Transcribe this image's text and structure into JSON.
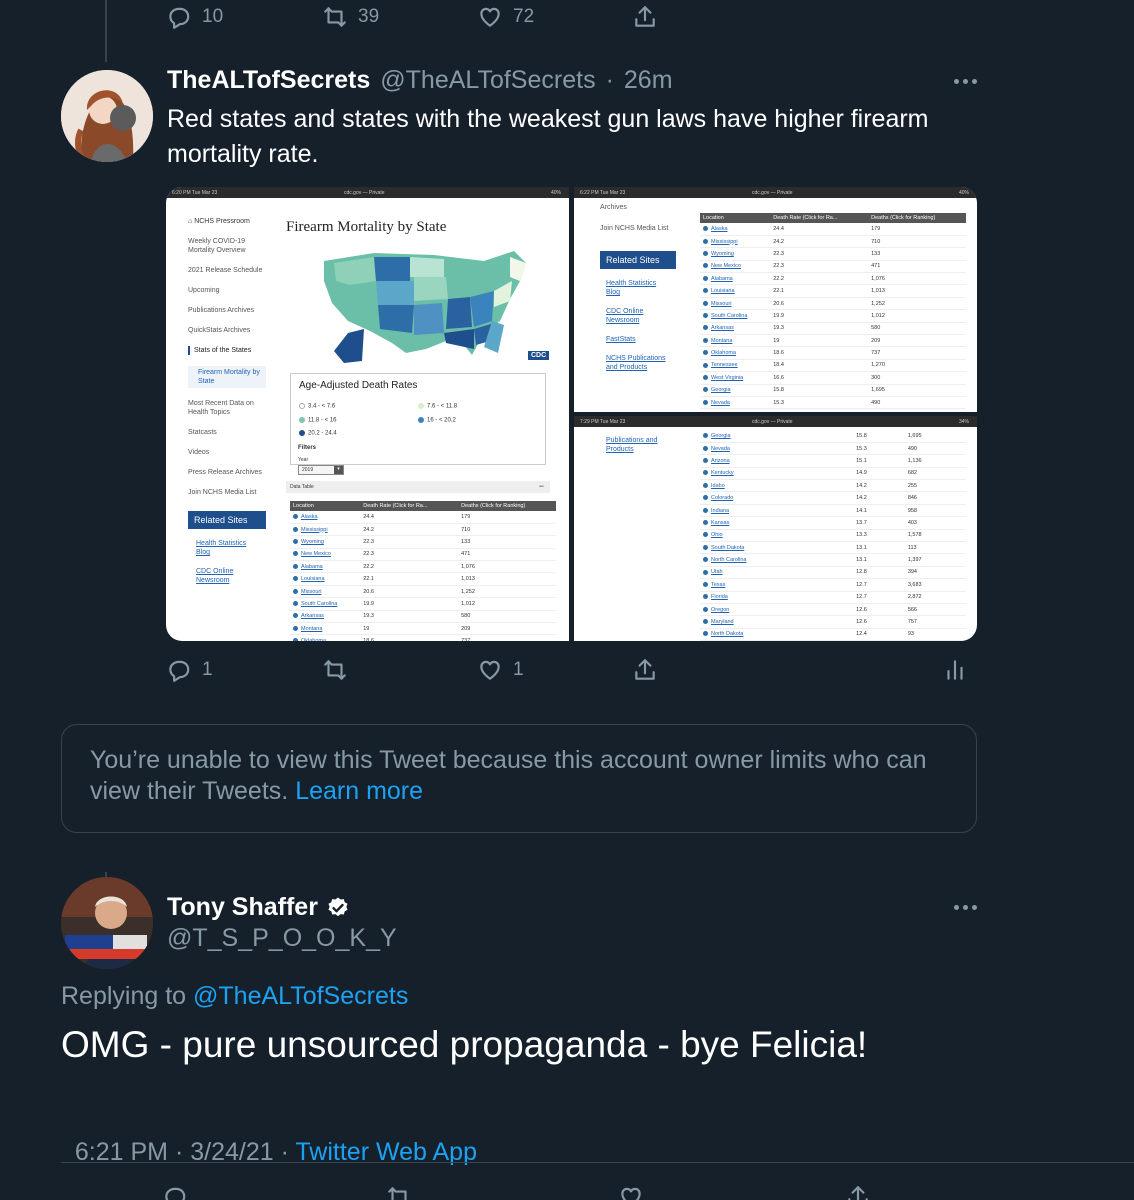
{
  "top_actions": {
    "replies": "10",
    "retweets": "39",
    "likes": "72"
  },
  "tweet1": {
    "display_name": "TheALTofSecrets",
    "handle": "@TheALTofSecrets",
    "time": "26m",
    "text": "Red states and states with the weakest gun laws have higher firearm mortality rate.",
    "replies": "1",
    "likes": "1",
    "image": {
      "left": {
        "status_time": "6:20 PM  Tue Mar 23",
        "url": "cdc.gov — Private",
        "battery": "40%",
        "nav_home": "NCHS Pressroom",
        "nav": [
          "Weekly COVID-19 Mortality Overview",
          "2021 Release Schedule",
          "Upcoming",
          "Publications Archives",
          "QuickStats Archives",
          "Stats of the States",
          "Firearm Mortality by State",
          "Most Recent Data on Health Topics",
          "Statcasts",
          "Videos",
          "Press Release Archives",
          "Join NCHS Media List"
        ],
        "related_sites": "Related Sites",
        "related_links": [
          "Health Statistics Blog",
          "CDC Online Newsroom"
        ],
        "map_title": "Firearm Mortality by State",
        "legend_title": "Age-Adjusted Death Rates",
        "legend": [
          "3.4 - < 7.6",
          "7.6 - < 11.8",
          "11.8 - < 16",
          "16 - < 20.2",
          "20.2 - 24.4"
        ],
        "filters": "Filters",
        "year_label": "Year",
        "year": "2019",
        "data_table": "Data Table",
        "cdc_logo": "CDC"
      },
      "right_top": {
        "status_time": "6:22 PM  Tue Mar 23",
        "url": "cdc.gov — Private",
        "battery": "40%",
        "nav_fragment": "Archives",
        "nav": [
          "Join NCHS Media List"
        ],
        "related_sites": "Related Sites",
        "related_links": [
          "Health Statistics Blog",
          "CDC Online Newsroom",
          "FastStats",
          "NCHS Publications and Products"
        ]
      },
      "right_bottom": {
        "status_time": "7:29 PM  Tue Mar 23",
        "url": "cdc.gov — Private",
        "battery": "34%",
        "related_links": [
          "Publications and Products"
        ]
      },
      "table_headers": [
        "Location",
        "Death Rate (Click for Ra...",
        "Deaths (Click for Ranking)"
      ],
      "rows_top": [
        [
          "Alaska",
          "24.4",
          "179"
        ],
        [
          "Mississippi",
          "24.2",
          "710"
        ],
        [
          "Wyoming",
          "22.3",
          "133"
        ],
        [
          "New Mexico",
          "22.3",
          "471"
        ],
        [
          "Alabama",
          "22.2",
          "1,076"
        ],
        [
          "Louisiana",
          "22.1",
          "1,013"
        ],
        [
          "Missouri",
          "20.6",
          "1,252"
        ],
        [
          "South Carolina",
          "19.9",
          "1,012"
        ],
        [
          "Arkansas",
          "19.3",
          "580"
        ],
        [
          "Montana",
          "19",
          "209"
        ],
        [
          "Oklahoma",
          "18.6",
          "737"
        ],
        [
          "Tennessee",
          "18.4",
          "1,270"
        ],
        [
          "West Virginia",
          "16.6",
          "300"
        ],
        [
          "Georgia",
          "15.8",
          "1,695"
        ],
        [
          "Nevada",
          "15.3",
          "490"
        ]
      ],
      "rows_bottom": [
        [
          "Georgia",
          "15.8",
          "1,695"
        ],
        [
          "Nevada",
          "15.3",
          "490"
        ],
        [
          "Arizona",
          "15.1",
          "1,136"
        ],
        [
          "Kentucky",
          "14.9",
          "682"
        ],
        [
          "Idaho",
          "14.2",
          "255"
        ],
        [
          "Colorado",
          "14.2",
          "846"
        ],
        [
          "Indiana",
          "14.1",
          "958"
        ],
        [
          "Kansas",
          "13.7",
          "403"
        ],
        [
          "Ohio",
          "13.3",
          "1,578"
        ],
        [
          "South Dakota",
          "13.1",
          "113"
        ],
        [
          "North Carolina",
          "13.1",
          "1,397"
        ],
        [
          "Utah",
          "12.8",
          "394"
        ],
        [
          "Texas",
          "12.7",
          "3,683"
        ],
        [
          "Florida",
          "12.7",
          "2,872"
        ],
        [
          "Oregon",
          "12.6",
          "566"
        ],
        [
          "Maryland",
          "12.6",
          "757"
        ],
        [
          "North Dakota",
          "12.4",
          "93"
        ]
      ]
    }
  },
  "unavailable": {
    "text": "You’re unable to view this Tweet because this account owner limits who can view their Tweets.",
    "link": "Learn more"
  },
  "tweet2": {
    "display_name": "Tony Shaffer",
    "handle": "@T_S_P_O_O_K_Y",
    "replying_label": "Replying to",
    "replying_to": "@TheALTofSecrets",
    "text": "OMG - pure unsourced propaganda - bye Felicia!",
    "timestamp": "6:21 PM · 3/24/21 · ",
    "source": "Twitter Web App"
  },
  "colors": {
    "background": "#15202b",
    "text": "#ffffff",
    "muted": "#8899a6",
    "accent": "#1da1f2",
    "border": "#38444d"
  },
  "icons": [
    "reply-icon",
    "retweet-icon",
    "like-icon",
    "share-icon",
    "analytics-icon",
    "verified-icon",
    "more-icon"
  ]
}
